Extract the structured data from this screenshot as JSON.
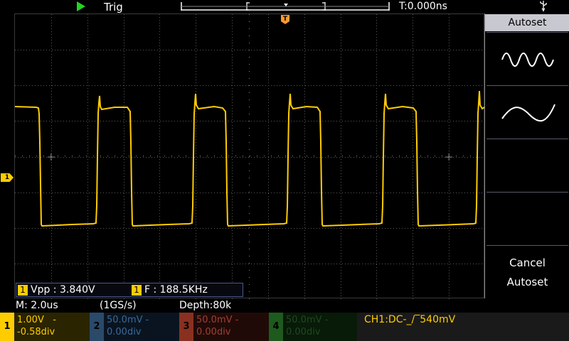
{
  "topbar": {
    "run_state_icon": "play-icon",
    "trigger_status": "Trig",
    "trigger_time": "T:0.000ns",
    "usb_icon": "usb-icon"
  },
  "measurements": {
    "vpp_channel": "1",
    "vpp": "Vpp : 3.840V",
    "freq_channel": "1",
    "freq": "F : 188.5KHz"
  },
  "status": {
    "timebase": "M: 2.0us",
    "sample_rate": "(1GS/s)",
    "depth": "Depth:80k"
  },
  "markers": {
    "trigger": "T",
    "ch1": "1"
  },
  "menu": {
    "title": "Autoset",
    "option1_icon": "multi-period-wave-icon",
    "option2_icon": "single-period-wave-icon",
    "cancel_line1": "Cancel",
    "cancel_line2": "Autoset"
  },
  "channels": [
    {
      "num": "1",
      "volt": "1.00V",
      "coupling": "-",
      "offset": "-0.58div",
      "color": "#ffcc00",
      "bg": "#3a3000"
    },
    {
      "num": "2",
      "volt": "50.0mV",
      "coupling": "-",
      "offset": "0.00div",
      "color": "#3a6a9a",
      "bg": "#0a1420"
    },
    {
      "num": "3",
      "volt": "50.0mV",
      "coupling": "-",
      "offset": "0.00div",
      "color": "#a04030",
      "bg": "#200a08"
    },
    {
      "num": "4",
      "volt": "50.0mV",
      "coupling": "-",
      "offset": "0.00div",
      "color": "#2a7a2a",
      "bg": "#081a08"
    }
  ],
  "trigger_info": "CH1:DC-_/‾540mV",
  "colors": {
    "ch1": "#ffcc00",
    "trigger": "#ff9a2a",
    "run": "#22d422"
  }
}
